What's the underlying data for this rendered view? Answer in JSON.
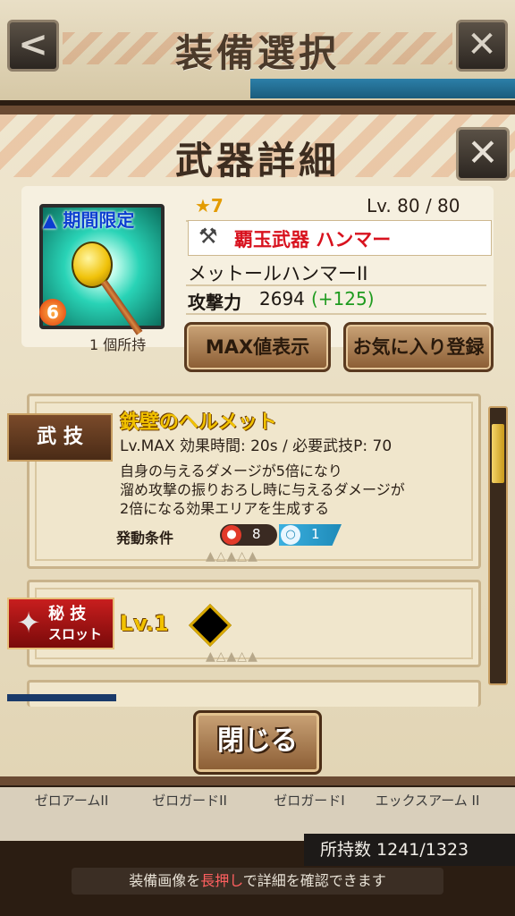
{
  "screen": {
    "title": "装備選択",
    "back_icon": "back-arrow-icon",
    "close_icon": "close-icon"
  },
  "dialog": {
    "title": "武器詳細",
    "close_icon": "close-icon",
    "weapon": {
      "limited_tag": "期間限定",
      "element_badge": "6",
      "owned": "1 個所持",
      "rarity": "★7",
      "level": "Lv. 80 / 80",
      "category": "覇玉武器 ハンマー",
      "name": "メットールハンマーII",
      "attack_label": "攻撃力",
      "attack_value": "2694",
      "attack_bonus": "(+125)"
    },
    "buttons": {
      "max_display": "MAX値表示",
      "favorite": "お気に入り登録",
      "close": "閉じる"
    },
    "skill": {
      "ribbon": "武 技",
      "name": "鉄壁のヘルメット",
      "meta": "Lv.MAX 効果時間: 20s / 必要武技P: 70",
      "desc_line1": "自身の与えるダメージが5倍になり",
      "desc_line2": "溜め攻撃の振りおろし時に与えるダメージが",
      "desc_line3": "2倍になる効果エリアを生成する",
      "condition_label": "発動条件",
      "cond_red_count": "8",
      "cond_blue_count": "1"
    },
    "secret_slot": {
      "ribbon_line1": "秘 技",
      "ribbon_line2": "スロット",
      "level": "Lv.1"
    }
  },
  "list": {
    "items": [
      "ゼロアームII",
      "ゼロガードII",
      "ゼロガードI",
      "エックスアーム II"
    ],
    "owned_total": "所持数 1241/1323"
  },
  "footer": {
    "pre": "装備画像を",
    "highlight": "長押し",
    "post": "で詳細を確認できます"
  },
  "colors": {
    "accent_gold": "#f2c200",
    "category_red": "#d8121e",
    "bonus_green": "#1f9b1f"
  }
}
